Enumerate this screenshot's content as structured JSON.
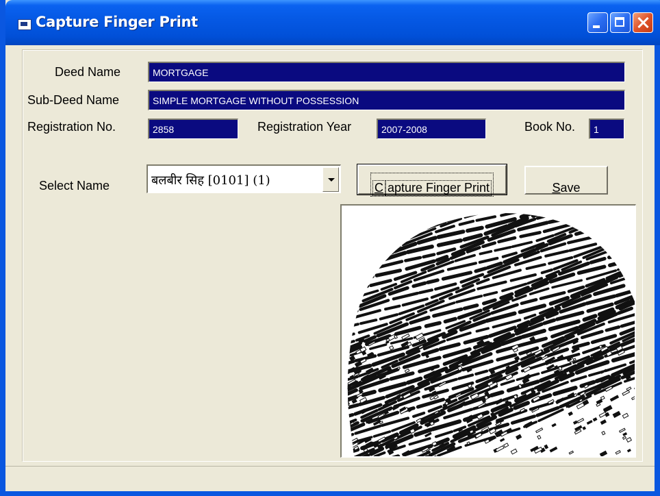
{
  "window": {
    "title": "Capture Finger Print"
  },
  "form": {
    "deed_name": {
      "label": "Deed Name",
      "value": "MORTGAGE"
    },
    "sub_deed_name": {
      "label": "Sub-Deed Name",
      "value": "SIMPLE MORTGAGE WITHOUT POSSESSION"
    },
    "registration_no": {
      "label": "Registration No.",
      "value": "2858"
    },
    "registration_year": {
      "label": "Registration Year",
      "value": "2007-2008"
    },
    "book_no": {
      "label": "Book No.",
      "value": "1"
    },
    "select_name": {
      "label": "Select Name",
      "selected": "बलबीर सिह [0101] (1)"
    }
  },
  "buttons": {
    "capture_prefix": "C",
    "capture_rest": "apture Finger Print",
    "save_prefix": "S",
    "save_rest": "ave"
  },
  "colors": {
    "titlebar": "#0558e3",
    "field_bg": "#0a0a80",
    "window_bg": "#ece9d8"
  },
  "icons": [
    "app-icon",
    "minimize-icon",
    "maximize-icon",
    "close-icon",
    "dropdown-arrow-icon",
    "fingerprint-image"
  ]
}
